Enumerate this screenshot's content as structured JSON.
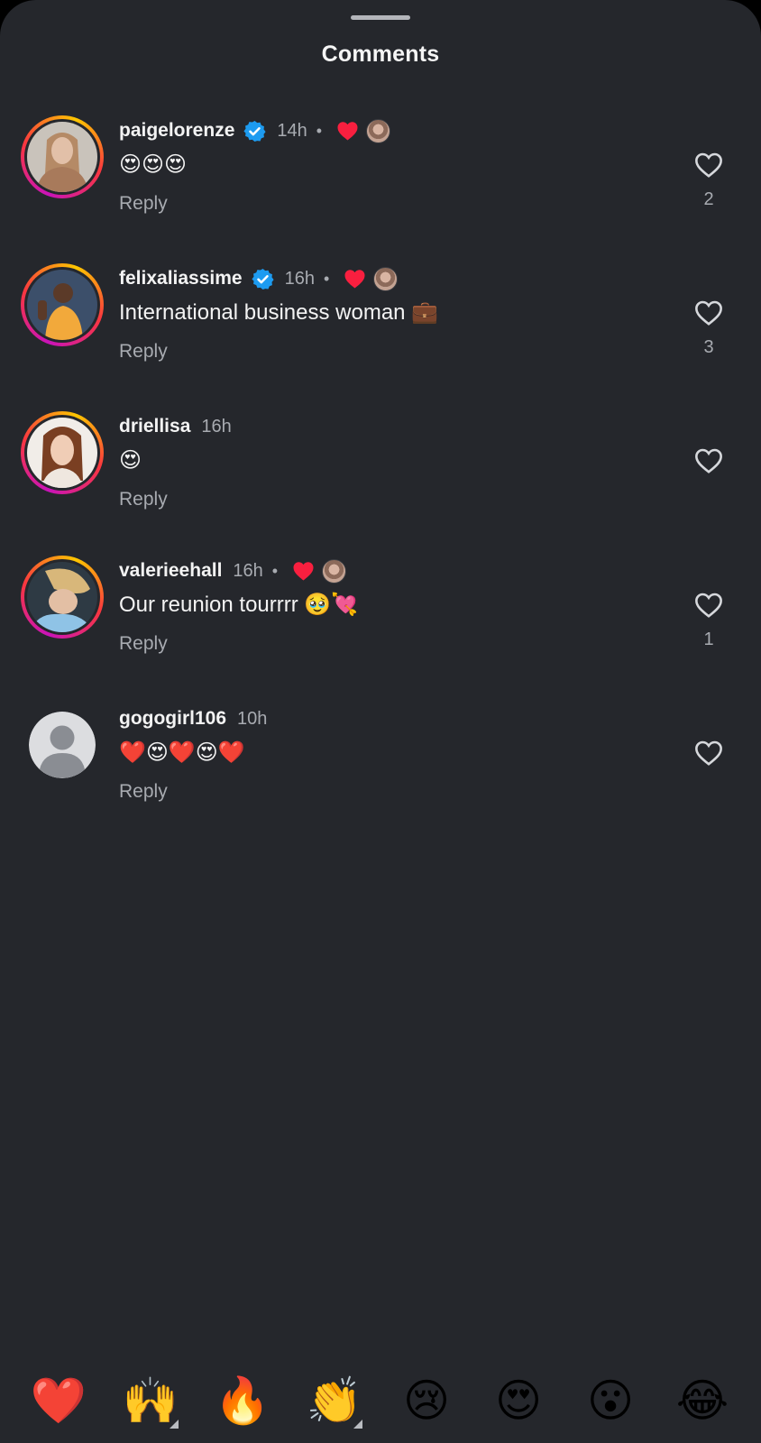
{
  "header": {
    "title": "Comments"
  },
  "colors": {
    "background": "#25272c",
    "text_primary": "#f3f3f3",
    "text_secondary": "#a8abb1",
    "verified_blue": "#1d9bf0",
    "heart_red": "#f91f3f"
  },
  "comments": [
    {
      "username": "paigelorenze",
      "verified": true,
      "time": "14h",
      "liked_by_creator": true,
      "text": "😍😍😍",
      "reply_label": "Reply",
      "likes": "2",
      "story_ring": true
    },
    {
      "username": "felixaliassime",
      "verified": true,
      "time": "16h",
      "liked_by_creator": true,
      "text": "International business woman 💼",
      "reply_label": "Reply",
      "likes": "3",
      "story_ring": true
    },
    {
      "username": "driellisa",
      "verified": false,
      "time": "16h",
      "liked_by_creator": false,
      "text": "😍",
      "reply_label": "Reply",
      "likes": "",
      "story_ring": true
    },
    {
      "username": "valerieehall",
      "verified": false,
      "time": "16h",
      "liked_by_creator": true,
      "text": "Our reunion tourrrr 🥹💘",
      "reply_label": "Reply",
      "likes": "1",
      "story_ring": true
    },
    {
      "username": "gogogirl106",
      "verified": false,
      "time": "10h",
      "liked_by_creator": false,
      "text": "❤️😍❤️😍❤️",
      "reply_label": "Reply",
      "likes": "",
      "story_ring": false
    }
  ],
  "quick_reactions": [
    {
      "emoji": "❤️",
      "has_variants": false
    },
    {
      "emoji": "🙌",
      "has_variants": true
    },
    {
      "emoji": "🔥",
      "has_variants": false
    },
    {
      "emoji": "👏",
      "has_variants": true
    },
    {
      "emoji": "😢",
      "has_variants": false
    },
    {
      "emoji": "😍",
      "has_variants": false
    },
    {
      "emoji": "😮",
      "has_variants": false
    },
    {
      "emoji": "😂",
      "has_variants": false
    }
  ]
}
